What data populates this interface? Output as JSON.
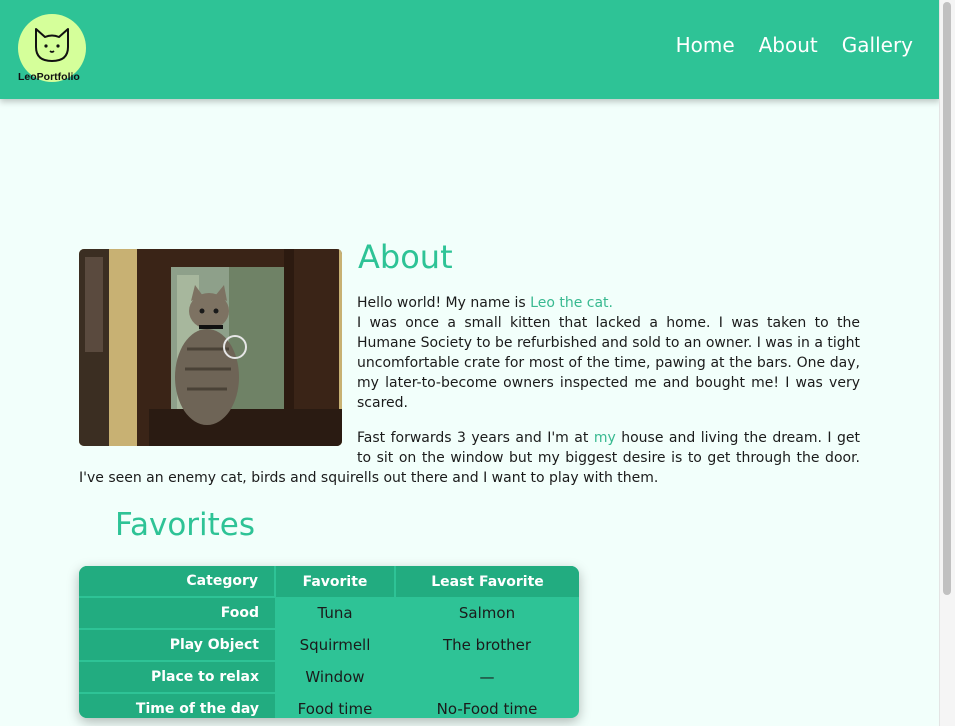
{
  "brand": {
    "logo_text": "LeoPortfolio",
    "accent_color": "#2ec396",
    "logo_bg": "#d5ff9a"
  },
  "nav": {
    "items": [
      "Home",
      "About",
      "Gallery"
    ]
  },
  "about": {
    "title": "About",
    "intro": "Hello world! My name is ",
    "name_link": "Leo the cat.",
    "p1": "I was once a small kitten that lacked a home. I was taken to the Humane Society to be refurbished and sold to an owner. I was in a tight uncomfortable crate for most of the time, pawing at the bars. One day, my later-to-become owners inspected me and bought me! I was very scared.",
    "p2_before": "Fast forwards 3 years and I'm at ",
    "p2_link": "my",
    "p2_after": " house and living the dream. I get to sit on the window but my biggest desire is to get through the door. I've seen an enemy cat, birds and squirells out there and I want to play with them.",
    "photo_icon": "cat-photo"
  },
  "favorites": {
    "title": "Favorites",
    "headers": [
      "Category",
      "Favorite",
      "Least Favorite"
    ],
    "rows": [
      [
        "Food",
        "Tuna",
        "Salmon"
      ],
      [
        "Play Object",
        "Squirmell",
        "The brother"
      ],
      [
        "Place to relax",
        "Window",
        "—"
      ],
      [
        "Time of the day",
        "Food time",
        "No-Food time"
      ]
    ]
  }
}
